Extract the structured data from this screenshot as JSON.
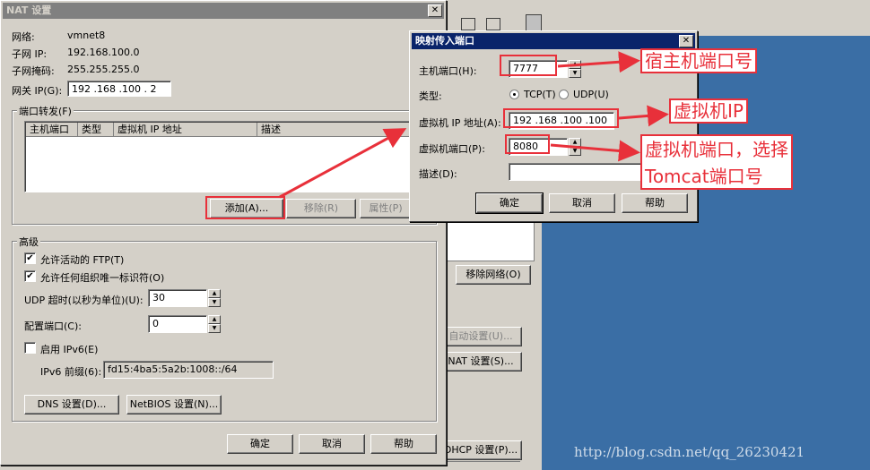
{
  "nat_dialog": {
    "title": "NAT 设置",
    "close": "✕",
    "network_label": "网络:",
    "network_value": "vmnet8",
    "subnet_ip_label": "子网 IP:",
    "subnet_ip_value": "192.168.100.0",
    "subnet_mask_label": "子网掩码:",
    "subnet_mask_value": "255.255.255.0",
    "gateway_label": "网关 IP(G):",
    "gateway_value": "192 .168 .100 . 2",
    "port_forward_title": "端口转发(F)",
    "columns": [
      "主机端口",
      "类型",
      "虚拟机 IP 地址",
      "描述"
    ],
    "add_button": "添加(A)...",
    "remove_button": "移除(R)",
    "properties_button": "属性(P)",
    "advanced_title": "高级",
    "allow_ftp": "允许活动的 FTP(T)",
    "allow_oui": "允许任何组织唯一标识符(O)",
    "udp_timeout_label": "UDP 超时(以秒为单位)(U):",
    "udp_timeout_value": "30",
    "config_port_label": "配置端口(C):",
    "config_port_value": "0",
    "enable_ipv6": "启用 IPv6(E)",
    "ipv6_prefix_label": "IPv6 前缀(6):",
    "ipv6_prefix_value": "fd15:4ba5:5a2b:1008::/64",
    "dns_button": "DNS 设置(D)...",
    "netbios_button": "NetBIOS 设置(N)...",
    "ok_button": "确定",
    "cancel_button": "取消",
    "help_button": "帮助"
  },
  "map_dialog": {
    "title": "映射传入端口",
    "close": "✕",
    "host_port_label": "主机端口(H):",
    "host_port_value": "7777",
    "type_label": "类型:",
    "tcp_label": "TCP(T)",
    "udp_label": "UDP(U)",
    "vm_ip_label": "虚拟机 IP 地址(A):",
    "vm_ip_value": "192 .168 .100 .100",
    "vm_port_label": "虚拟机端口(P):",
    "vm_port_value": "8080",
    "desc_label": "描述(D):",
    "desc_value": "",
    "ok_button": "确定",
    "cancel_button": "取消",
    "help_button": "帮助"
  },
  "background": {
    "remove_network_button": "移除网络(O)",
    "auto_settings_button": "自动设置(U)...",
    "nat_settings_button": "NAT 设置(S)...",
    "dhcp_settings_button": "DHCP 设置(P)..."
  },
  "annotations": {
    "host_port_note": "宿主机端口号",
    "vm_ip_note": "虚拟机IP",
    "vm_port_note_line1": "虚拟机端口，选择",
    "vm_port_note_line2": "Tomcat端口号"
  },
  "watermark": "http://blog.csdn.net/qq_26230421",
  "colors": {
    "annotation_red": "#e8303a",
    "desktop_blue": "#3a6ea5",
    "active_title": "#0a246a"
  }
}
